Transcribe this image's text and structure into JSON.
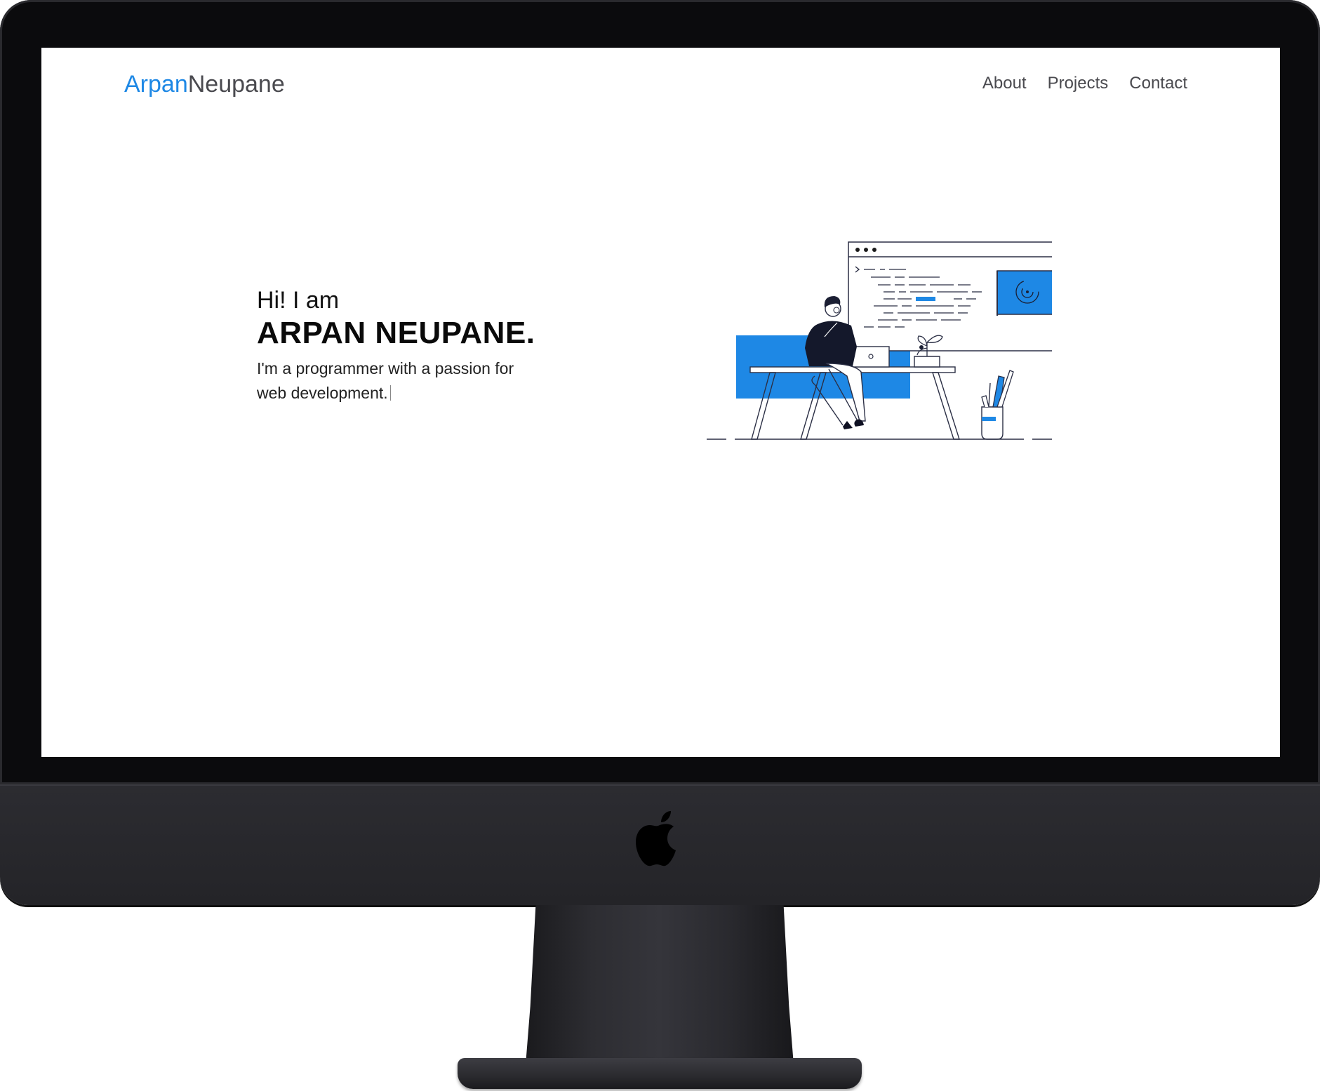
{
  "site": {
    "brand_first": "Arpan",
    "brand_last": "Neupane",
    "accent_color": "#1e88e5",
    "nav": {
      "about": "About",
      "projects": "Projects",
      "contact": "Contact"
    }
  },
  "hero": {
    "greeting": "Hi! I am",
    "name": "ARPAN NEUPANE.",
    "tagline": "I'm a programmer with a passion for web development."
  },
  "device": {
    "model_icon": "apple-logo-icon",
    "illustration": "developer-at-desk-illustration"
  }
}
